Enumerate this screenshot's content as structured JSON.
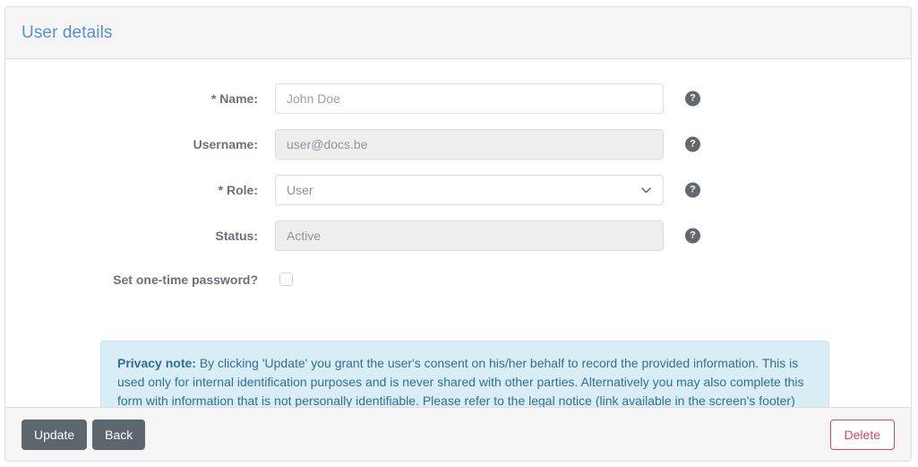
{
  "panel": {
    "title": "User details"
  },
  "form": {
    "fields": [
      {
        "label": "* Name:",
        "value": "John Doe",
        "placeholder": "John Doe",
        "type": "text",
        "disabled": false,
        "help_icon": "help-icon",
        "help_glyph": "?"
      },
      {
        "label": "Username:",
        "value": "user@docs.be",
        "placeholder": "user@docs.be",
        "type": "text",
        "disabled": true,
        "help_icon": "help-icon",
        "help_glyph": "?"
      },
      {
        "label": "* Role:",
        "value": "User",
        "type": "select",
        "options": [
          "User"
        ],
        "disabled": false,
        "caret_icon": "chevron-down-icon",
        "help_icon": "help-icon",
        "help_glyph": "?"
      },
      {
        "label": "Status:",
        "value": "Active",
        "placeholder": "Active",
        "type": "text",
        "disabled": true,
        "help_icon": "help-icon",
        "help_glyph": "?"
      }
    ],
    "checkbox": {
      "label": "Set one-time password?",
      "checked": false
    }
  },
  "privacy_note": {
    "heading": "Privacy note:",
    "body": " By clicking 'Update' you grant the user's consent on his/her behalf to record the provided information. This is used only for internal identification purposes and is never shared with other parties. Alternatively you may also complete this form with information that is not personally identifiable. Please refer to the legal notice (link available in the screen's footer) for more information."
  },
  "footer": {
    "update_label": "Update",
    "back_label": "Back",
    "delete_label": "Delete"
  },
  "colors": {
    "title": "#5b8fc7",
    "label": "#6b7176",
    "note_bg": "#d9edf7",
    "note_text": "#31708f",
    "btn_default_bg": "#5d666d",
    "btn_danger": "#d9455f",
    "panel_header_bg": "#f5f5f5",
    "border": "#dddddd"
  }
}
